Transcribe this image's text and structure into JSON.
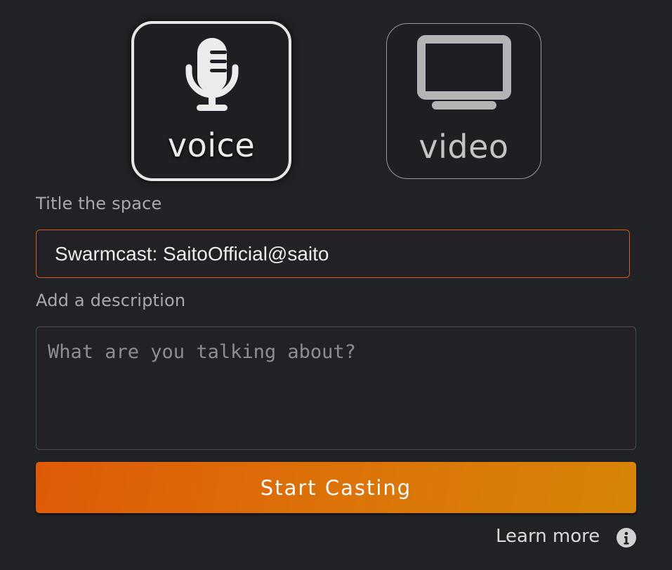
{
  "modes": {
    "voice": {
      "label": "voice",
      "icon": "microphone-icon",
      "selected": true
    },
    "video": {
      "label": "video",
      "icon": "monitor-icon",
      "selected": false
    }
  },
  "title_field": {
    "label": "Title the space",
    "value": "Swarmcast: SaitoOfficial@saito"
  },
  "description_field": {
    "label": "Add a description",
    "placeholder": "What are you talking about?"
  },
  "start_button": {
    "label": "Start Casting"
  },
  "learn_more": {
    "label": "Learn more",
    "icon": "info-icon"
  },
  "colors": {
    "background": "#212226",
    "accent_start": "#df5a08",
    "accent_end": "#d68406",
    "input_focus_border": "#d05f1a"
  }
}
